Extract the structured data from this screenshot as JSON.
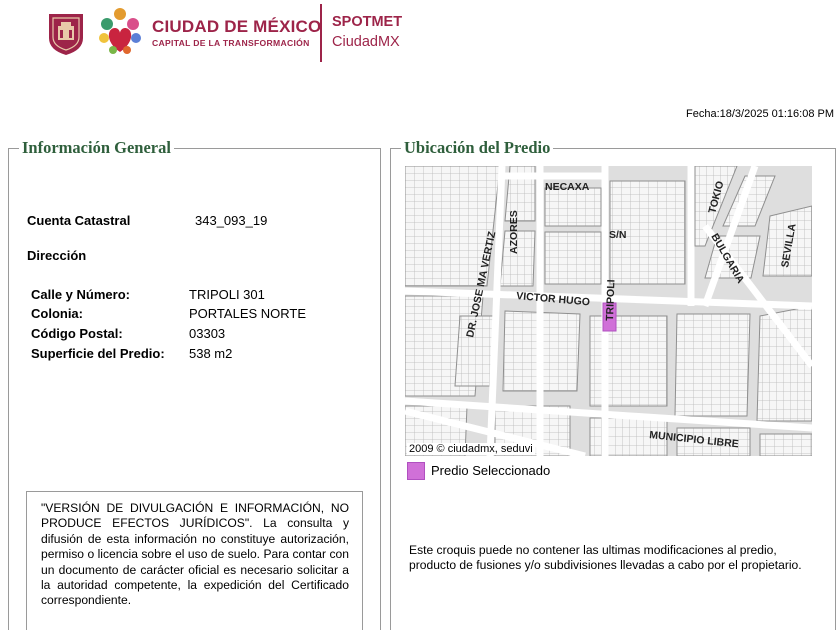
{
  "header": {
    "brand_title": "CIUDAD DE MÉXICO",
    "brand_subtitle": "CAPITAL DE LA TRANSFORMACIÓN",
    "app_title": "SPOTMET",
    "app_subtitle": "CiudadMX",
    "brand_color": "#9d2449"
  },
  "fecha": "Fecha:18/3/2025 01:16:08 PM",
  "info_general": {
    "legend": "Información General",
    "cuenta_label": "Cuenta Catastral",
    "cuenta_value": "343_093_19",
    "direccion_label": "Dirección",
    "fields": [
      {
        "label": "Calle y Número:",
        "value": "TRIPOLI 301"
      },
      {
        "label": "Colonia:",
        "value": "PORTALES NORTE"
      },
      {
        "label": "Código Postal:",
        "value": "03303"
      },
      {
        "label": "Superficie del Predio:",
        "value": "538 m2"
      }
    ],
    "disclaimer": "\"VERSIÓN DE DIVULGACIÓN E INFORMACIÓN, NO PRODUCE EFECTOS JURÍDICOS\". La consulta y difusión de esta información no constituye autorización, permiso o licencia sobre el uso de suelo. Para contar con un documento de carácter oficial es necesario solicitar a la autoridad competente, la expedición del Certificado correspondiente."
  },
  "ubicacion": {
    "legend": "Ubicación del Predio",
    "map_credit": "2009 © ciudadmx, seduvi",
    "streets": {
      "necaxa": "NECAXA",
      "tokio": "TOKIO",
      "azores": "AZORES",
      "sn": "S/N",
      "bulgaria": "BULGARIA",
      "sevilla": "SEVILLA",
      "jose_ma_vertiz": "DR. JOSE MA VERTIZ",
      "victor_hugo": "VICTOR HUGO",
      "tripoli": "TRIPOLI",
      "municipio_libre": "MUNICIPIO LIBRE"
    },
    "legend_label": "Predio Seleccionado",
    "legend_color": "#d070d8",
    "note": "Este croquis puede no contener las ultimas modificaciones al predio, producto de fusiones y/o subdivisiones llevadas a cabo por el propietario."
  }
}
